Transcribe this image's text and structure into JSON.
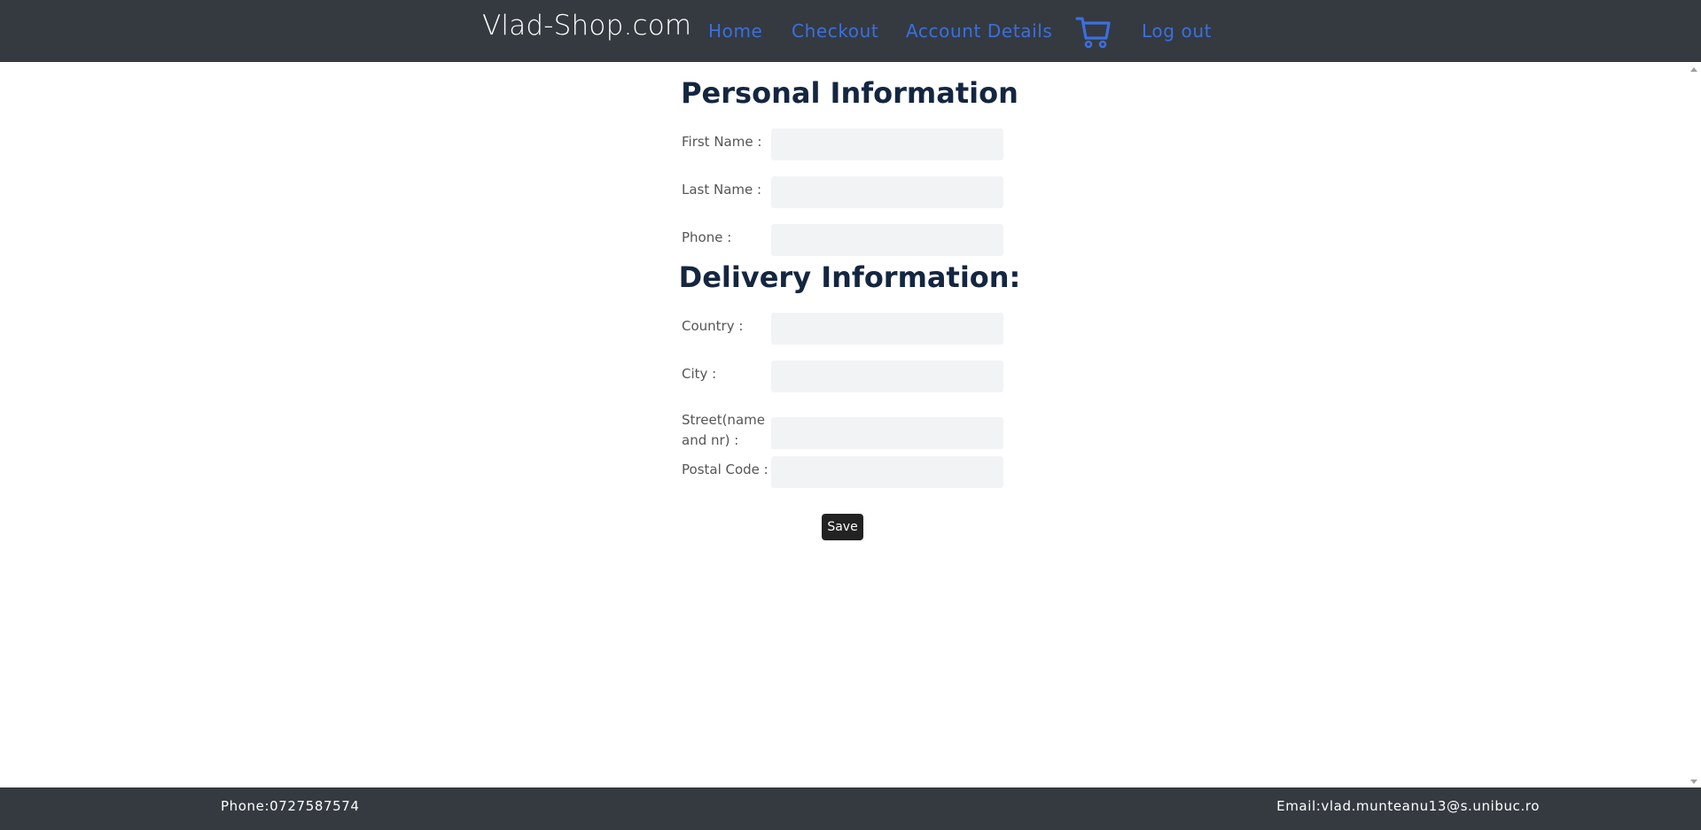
{
  "header": {
    "brand": "Vlad-Shop.com",
    "nav": {
      "home": "Home",
      "checkout": "Checkout",
      "account": "Account Details",
      "logout": "Log out"
    },
    "cart_icon": "shopping-cart-icon"
  },
  "personal": {
    "title": "Personal Information",
    "fields": {
      "first_name": {
        "label": "First Name :",
        "value": ""
      },
      "last_name": {
        "label": "Last Name :",
        "value": ""
      },
      "phone": {
        "label": "Phone :",
        "value": ""
      }
    }
  },
  "delivery": {
    "title": "Delivery Information:",
    "fields": {
      "country": {
        "label": "Country :",
        "value": ""
      },
      "city": {
        "label": "City :",
        "value": ""
      },
      "street": {
        "label": "Street(name and nr) :",
        "value": ""
      },
      "postal_code": {
        "label": "Postal Code :",
        "value": ""
      }
    }
  },
  "form": {
    "save_label": "Save"
  },
  "footer": {
    "phone": "Phone:0727587574",
    "email": "Email:vlad.munteanu13@s.unibuc.ro"
  },
  "colors": {
    "nav_bg": "#343a40",
    "link": "#3b6fe0",
    "heading": "#142640",
    "input_bg": "#f1f3f5",
    "button_bg": "#222222"
  }
}
